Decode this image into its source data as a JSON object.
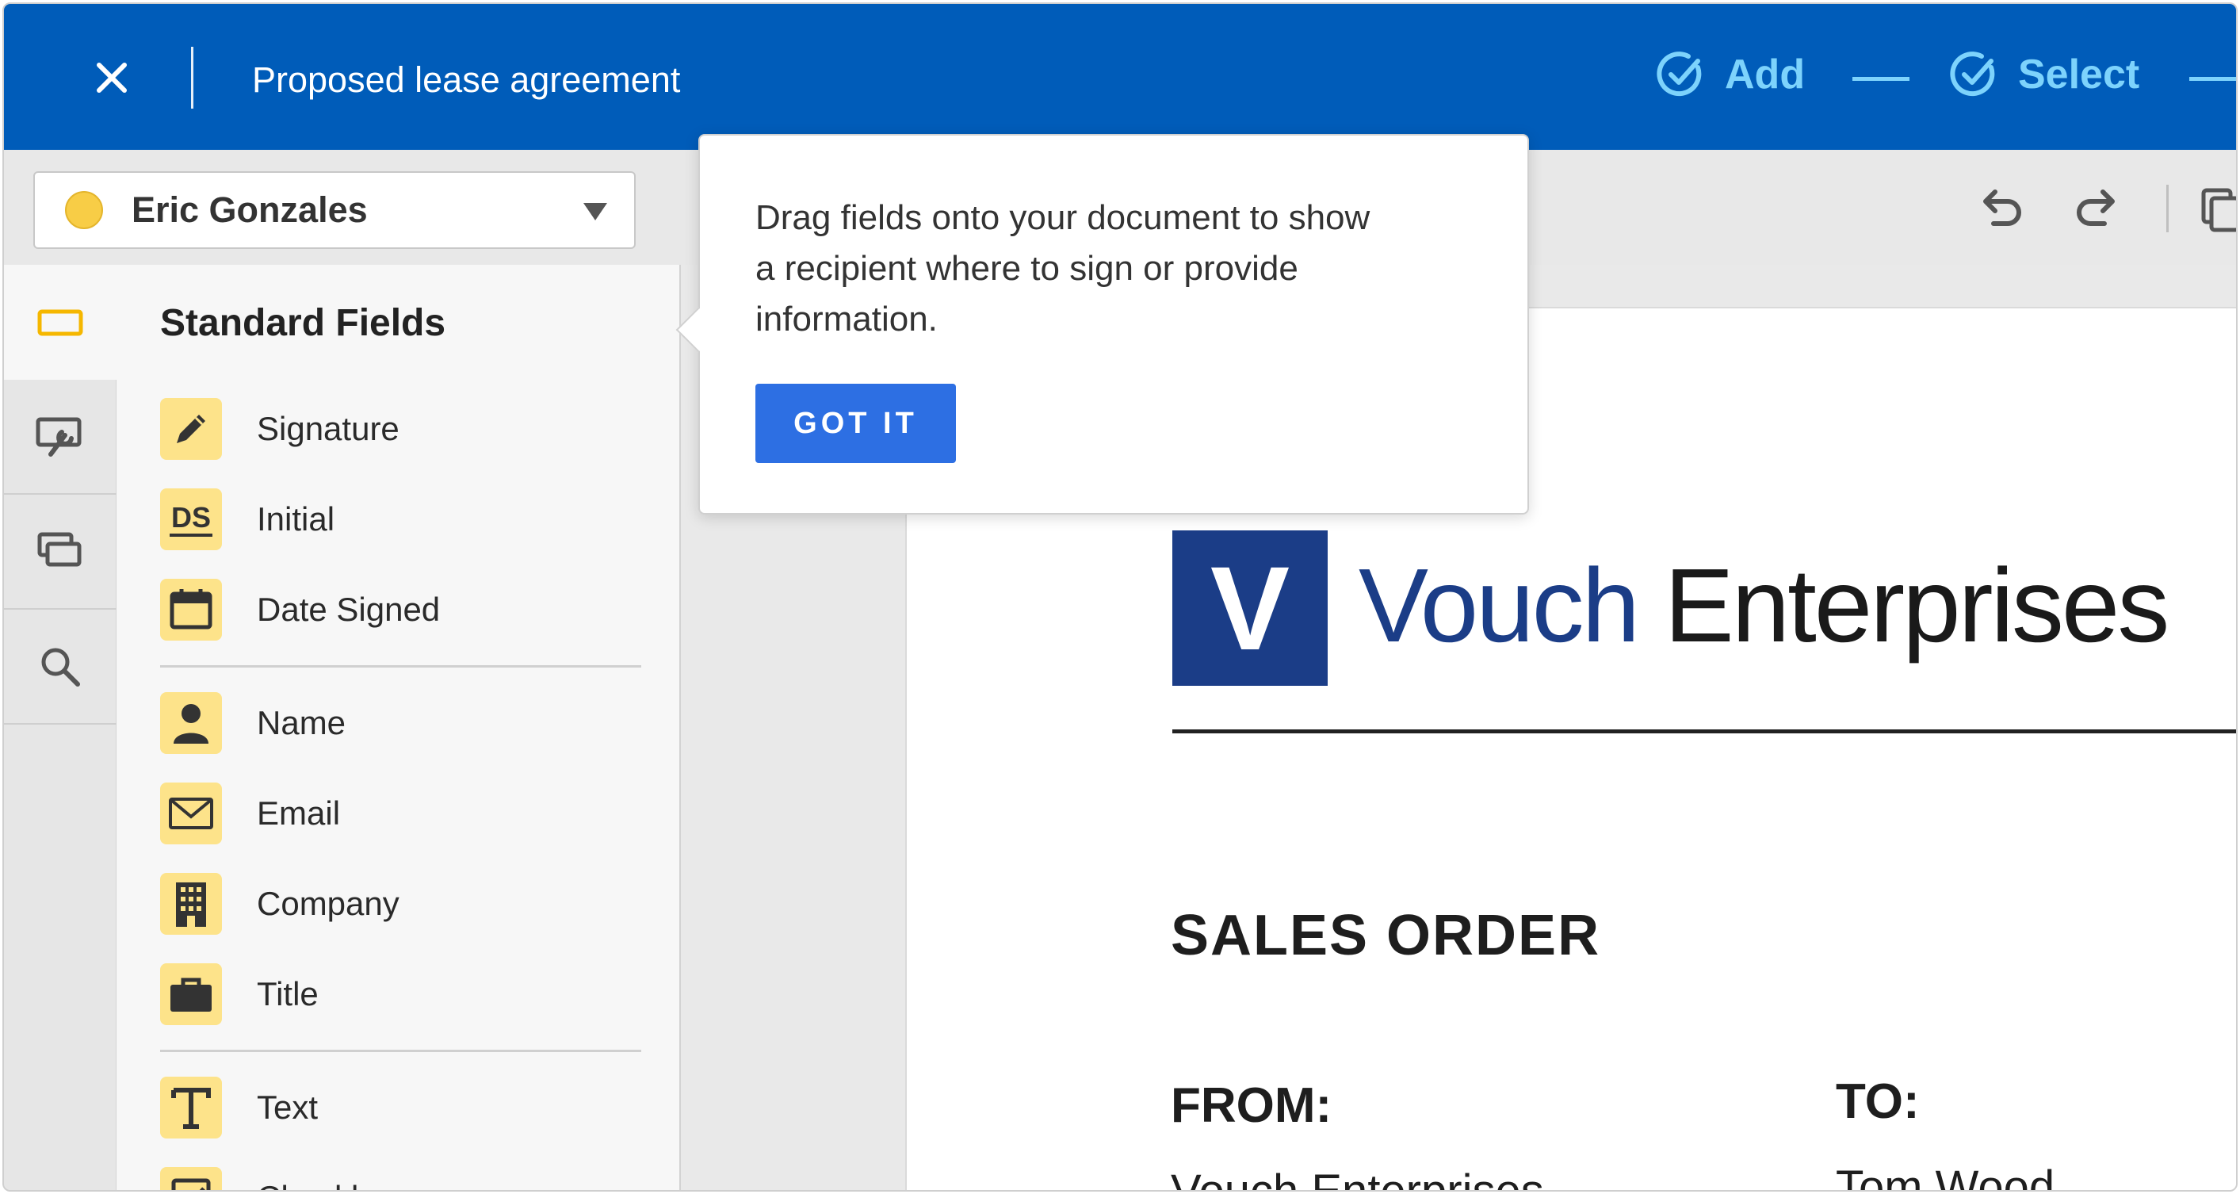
{
  "header": {
    "document_title": "Proposed lease agreement",
    "steps": [
      {
        "label": "Add"
      },
      {
        "label": "Select"
      }
    ]
  },
  "toolbar": {
    "recipient_name": "Eric Gonzales",
    "recipient_color": "#f8cd46"
  },
  "sidebar": {
    "title": "Standard Fields",
    "fields": [
      {
        "label": "Signature",
        "icon": "pen-icon"
      },
      {
        "label": "Initial",
        "icon": "initials-ds-icon"
      },
      {
        "label": "Date Signed",
        "icon": "calendar-icon"
      },
      {
        "label": "Name",
        "icon": "person-icon"
      },
      {
        "label": "Email",
        "icon": "envelope-icon"
      },
      {
        "label": "Company",
        "icon": "building-icon"
      },
      {
        "label": "Title",
        "icon": "briefcase-icon"
      },
      {
        "label": "Text",
        "icon": "text-t-icon"
      },
      {
        "label": "Checkbox",
        "icon": "checkbox-icon"
      }
    ]
  },
  "popover": {
    "message": "Drag fields onto your document to show a recipient where to sign or provide information.",
    "button_label": "GOT IT"
  },
  "document": {
    "logo_letter": "V",
    "logo_word1": "Vouch",
    "logo_word2": "Enterprises",
    "heading": "SALES ORDER",
    "from_label": "FROM:",
    "to_label": "TO:",
    "from_value": "Vouch Enterprises",
    "to_value": "Tom Wood"
  },
  "colors": {
    "header_blue": "#005cb9",
    "step_accent": "#7dd3fc",
    "field_icon_bg": "#fde38a",
    "button_blue": "#2d6fe3",
    "logo_navy": "#1b3d87"
  }
}
